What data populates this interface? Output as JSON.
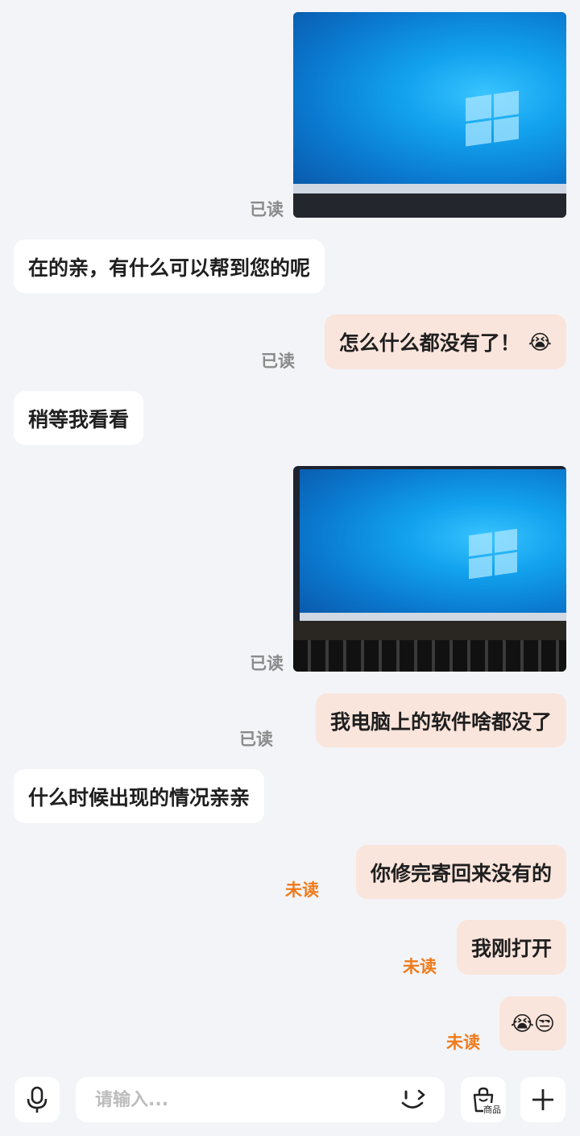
{
  "messages": [
    {
      "id": "m1",
      "side": "right",
      "type": "image",
      "status": "已读",
      "image_desc": "laptop-screen-windows-desktop"
    },
    {
      "id": "m2",
      "side": "left",
      "type": "text",
      "text": "在的亲，有什么可以帮到您的呢"
    },
    {
      "id": "m3",
      "side": "right",
      "type": "text",
      "text": "怎么什么都没有了！",
      "emoji": "😭",
      "status": "已读"
    },
    {
      "id": "m4",
      "side": "left",
      "type": "text",
      "text": "稍等我看看"
    },
    {
      "id": "m5",
      "side": "right",
      "type": "image",
      "status": "已读",
      "image_desc": "laptop-screen-windows-desktop-with-keyboard"
    },
    {
      "id": "m6",
      "side": "right",
      "type": "text",
      "text": "我电脑上的软件啥都没了",
      "status": "已读"
    },
    {
      "id": "m7",
      "side": "left",
      "type": "text",
      "text": "什么时候出现的情况亲亲"
    },
    {
      "id": "m8",
      "side": "right",
      "type": "text",
      "text": "你修完寄回来没有的",
      "status": "未读"
    },
    {
      "id": "m9",
      "side": "right",
      "type": "text",
      "text": "我刚打开",
      "status": "未读"
    },
    {
      "id": "m10",
      "side": "right",
      "type": "text",
      "text": "😭😒",
      "status": "未读"
    }
  ],
  "input": {
    "placeholder": "请输入..."
  },
  "toolbar": {
    "voice_icon": "microphone-icon",
    "emoji_icon": "wink-face-icon",
    "goods_label": "商品",
    "goods_icon": "shopping-bag-icon",
    "plus_icon": "plus-icon"
  },
  "colors": {
    "background": "#f2f4f8",
    "left_bubble": "#ffffff",
    "right_bubble": "#fae5dc",
    "read_status": "#8a8a8a",
    "unread_status": "#f07a1a"
  }
}
